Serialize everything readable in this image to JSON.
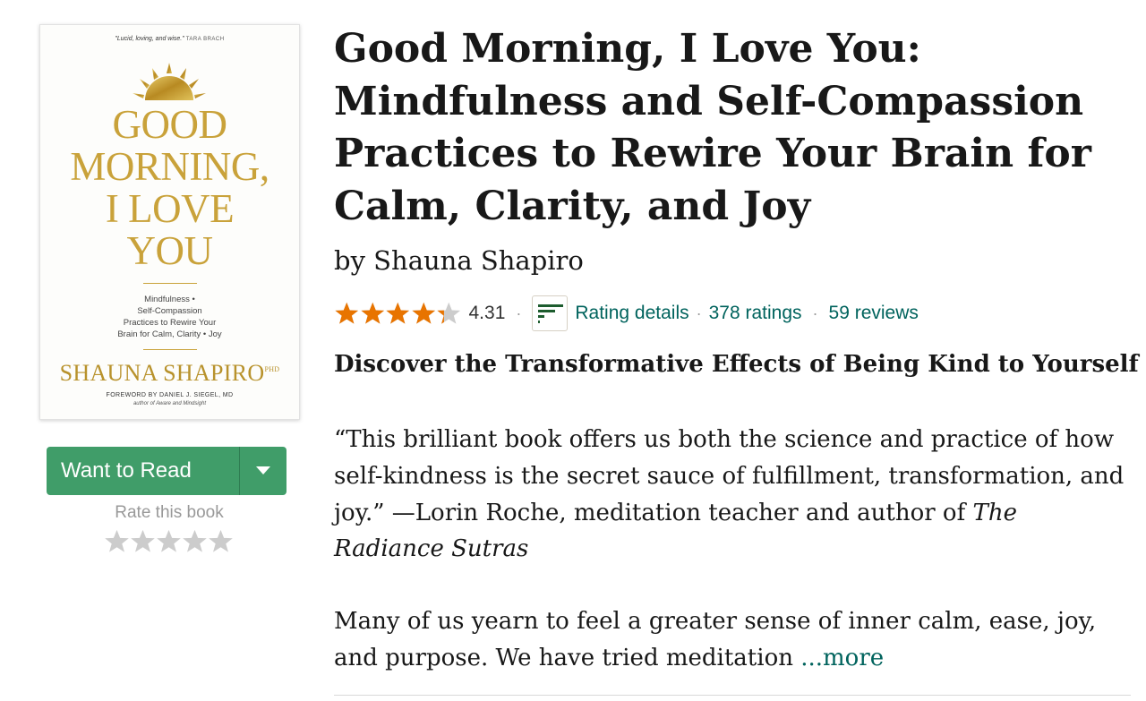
{
  "cover": {
    "quote": "\"Lucid, loving, and wise.\"",
    "quote_attr": "TARA BRACH",
    "title_lines": [
      "GOOD",
      "MORNING,",
      "I LOVE",
      "YOU"
    ],
    "subtitle_lines": [
      "Mindfulness •",
      "Self-Compassion",
      "Practices to Rewire Your",
      "Brain for Calm, Clarity • Joy"
    ],
    "author": "SHAUNA SHAPIRO",
    "author_suffix": "PHD",
    "foreword": "FOREWORD BY DANIEL J. SIEGEL, MD",
    "foreword_sub": "author of Aware and Mindsight"
  },
  "shelf": {
    "want_to_read": "Want to Read",
    "rate_label": "Rate this book"
  },
  "book": {
    "title": "Good Morning, I Love You: Mindfulness and Self-Compassion Practices to Rewire Your Brain for Calm, Clarity, and Joy",
    "by": "by",
    "author": "Shauna Shapiro",
    "average_rating": "4.31",
    "rating_value": 4.31,
    "rating_details": "Rating details",
    "ratings_count": "378 ratings",
    "reviews_count": "59 reviews",
    "separator": "·"
  },
  "description": {
    "tagline": "Discover the Transformative Effects of Being Kind to Yourself",
    "quote_text": "“This brilliant book offers us both the science and practice of how self-kindness is the secret sauce of fulfillment, transformation, and joy.” —Lorin Roche, meditation teacher and author of ",
    "quote_book": "The Radiance Sutras",
    "body": "Many of us yearn to feel a greater sense of inner calm, ease, joy, and purpose. We have tried meditation ",
    "more_link": "...more"
  },
  "colors": {
    "star_filled": "#e87400",
    "star_empty": "#cccccc",
    "button_green": "#409d69",
    "link": "#00635d",
    "cover_gold": "#c9a23a"
  }
}
